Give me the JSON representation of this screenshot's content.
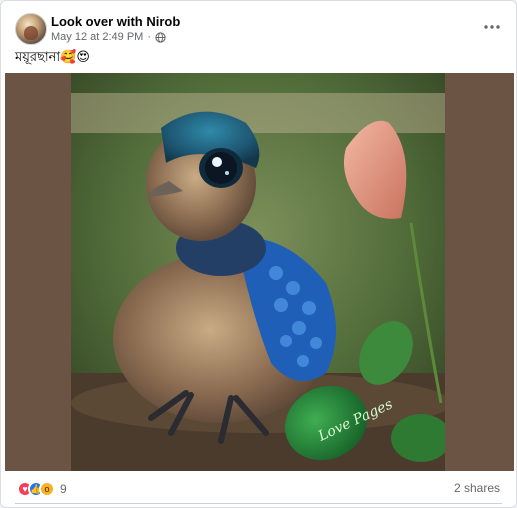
{
  "post": {
    "author": "Look over with Nirob",
    "date": "May 12 at 2:49 PM",
    "separator": "·",
    "caption": "ময়ূরছানা🥰😍",
    "reactions": {
      "icons": [
        "love-icon",
        "like-icon",
        "wow-icon"
      ],
      "count": "9"
    },
    "shares": "2 shares"
  },
  "colors": {
    "photo_backdrop": "#6b5443",
    "peacock_blue": "#1f5fb8",
    "love": "#f33e58",
    "like": "#1877f2",
    "wow": "#f7b125"
  },
  "watermark": "Love Pages"
}
